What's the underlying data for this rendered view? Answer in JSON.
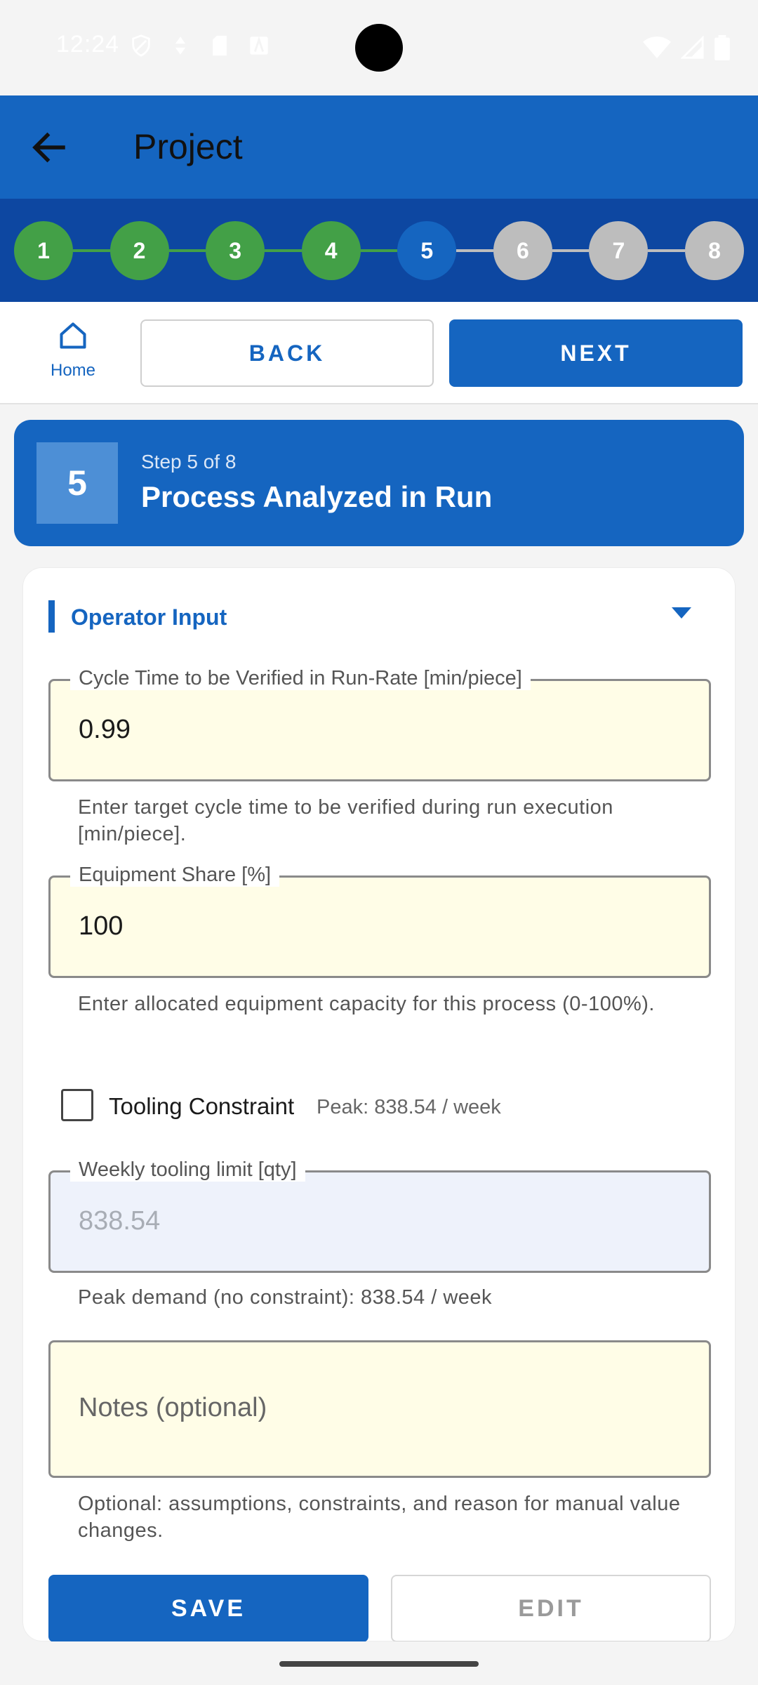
{
  "status_bar": {
    "time": "12:24",
    "left_icons": [
      "shield-icon",
      "data-saver-icon",
      "sd-card-icon",
      "font-icon"
    ],
    "right_icons": [
      "wifi-icon",
      "signal-icon",
      "battery-icon"
    ]
  },
  "app_bar": {
    "title": "Project",
    "back_icon": "arrow-left-icon",
    "color": "#1565c0"
  },
  "stepper": {
    "steps": [
      {
        "label": "1",
        "state": "done"
      },
      {
        "label": "2",
        "state": "done"
      },
      {
        "label": "3",
        "state": "done"
      },
      {
        "label": "4",
        "state": "done"
      },
      {
        "label": "5",
        "state": "current"
      },
      {
        "label": "6",
        "state": "todo"
      },
      {
        "label": "7",
        "state": "todo"
      },
      {
        "label": "8",
        "state": "todo"
      }
    ],
    "colors": {
      "done": "#43a047",
      "current": "#1565c0",
      "todo": "#bdbdbd",
      "bar": "#0d47a1"
    }
  },
  "nav": {
    "home_label": "Home",
    "back_label": "BACK",
    "next_label": "NEXT"
  },
  "step_header": {
    "number": "5",
    "subtitle": "Step 5 of 8",
    "title": "Process Analyzed in Run"
  },
  "form": {
    "section_title": "Operator Input",
    "cycle_time": {
      "label": "Cycle Time to be Verified in Run-Rate [min/piece]",
      "value": "0.99",
      "helper": "Enter target cycle time to be verified during run execution [min/piece]."
    },
    "equipment_share": {
      "label": "Equipment Share [%]",
      "value": "100",
      "helper": "Enter allocated equipment capacity for this process (0-100%)."
    },
    "tooling": {
      "checkbox_label": "Tooling Constraint",
      "checked": false,
      "peak_note": "Peak: 838.54 / week"
    },
    "weekly_limit": {
      "label": "Weekly tooling limit [qty]",
      "placeholder": "838.54",
      "helper": "Peak demand (no constraint): 838.54 / week"
    },
    "notes": {
      "placeholder": "Notes (optional)",
      "helper": "Optional: assumptions, constraints, and reason for manual value changes."
    },
    "save_label": "SAVE",
    "edit_label": "EDIT"
  },
  "colors": {
    "primary": "#1565c0",
    "field_bg": "#fffde7",
    "disabled_field_bg": "#eef2fb"
  }
}
